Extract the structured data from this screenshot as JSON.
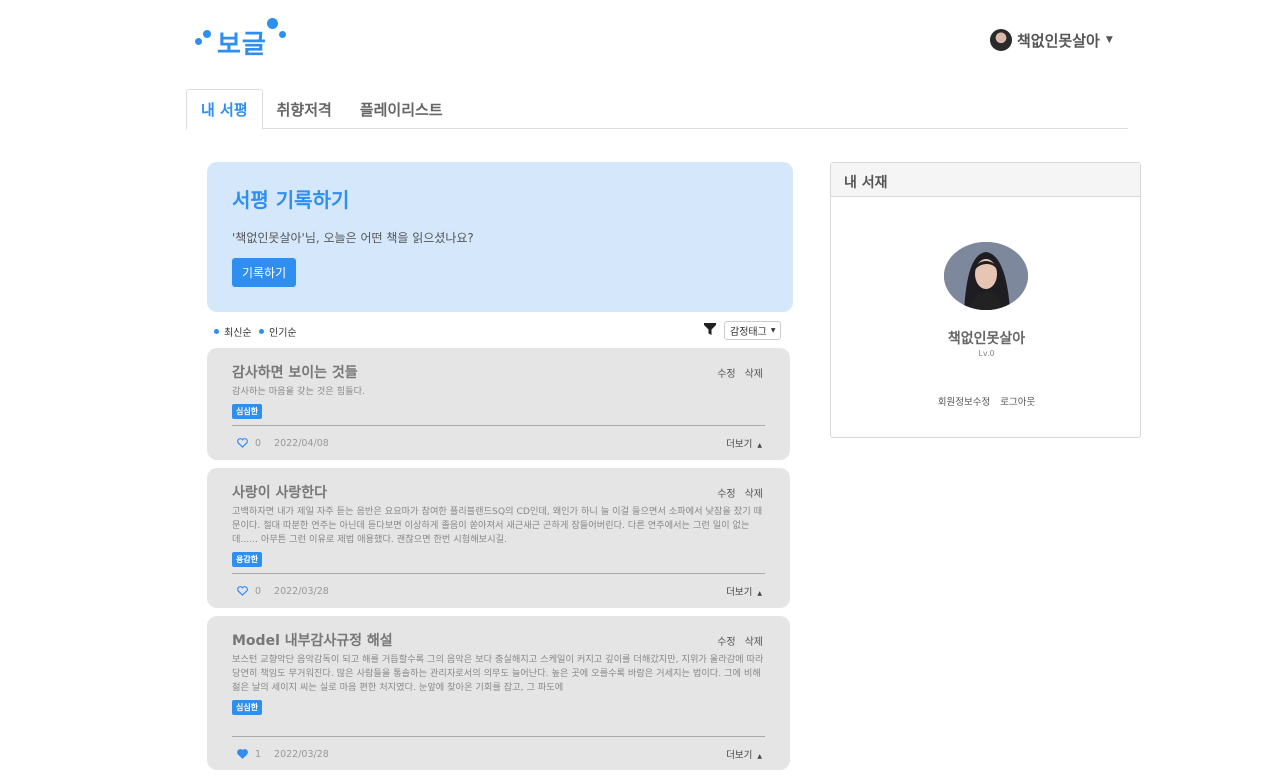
{
  "brand": {
    "logo_text": "보글",
    "color": "#2e8ff0"
  },
  "user": {
    "name": "책없인못살아"
  },
  "tabs": [
    {
      "label": "내 서평",
      "active": true
    },
    {
      "label": "취향저격",
      "active": false
    },
    {
      "label": "플레이리스트",
      "active": false
    }
  ],
  "hero": {
    "title": "서평 기록하기",
    "subtitle": "'책없인못살아'님, 오늘은 어떤 책을 읽으셨나요?",
    "button": "기록하기"
  },
  "sort": {
    "latest": "최신순",
    "popular": "인기순",
    "tag_select": "감정태그"
  },
  "reviews": [
    {
      "title": "감사하면 보이는 것들",
      "body": "감사하는 마음을 갖는 것은 힘들다.",
      "tag": "심심한",
      "likes": "0",
      "date": "2022/04/08",
      "liked": false
    },
    {
      "title": "사랑이 사랑한다",
      "body": "고백하자면 내가 제일 자주 듣는 음반은 요요마가 참여한 플리블랜드SQ의 CD인데, 왜인가 하니 늘 이걸 들으면서 소파에서 낮잠을 잤기 때문이다. 절대 따분한 연주는 아닌데 듣다보면 이상하게 졸음이 쏟아져서 새근새근 곤하게 잠들어버린다. 다른 연주에서는 그런 일이 없는데...... 아무튼 그런 이유로 제법 애용했다. 괜찮으면 한번 시험해보시길.",
      "tag": "용감한",
      "likes": "0",
      "date": "2022/03/28",
      "liked": false
    },
    {
      "title": "Model 내부감사규정 해설",
      "body": "보스턴 교향악단 음악감독이 되고 해를 거듭할수록 그의 음악은 보다 충실해지고 스케일이 커지고 깊이를 더해갔지만, 지위가 올라감에 따라 당연히 책임도 무거워진다. 많은 사람들을 통솔하는 관리자로서의 의무도 늘어난다. 높은 곳에 오를수록 바람은 거세지는 법이다. 그에 비해 젊은 날의 세이지 씨는 실로 마음 편한 처지였다. 눈앞에 찾아온 기회를 잡고, 그 파도에",
      "tag": "심심한",
      "likes": "1",
      "date": "2022/03/28",
      "liked": true
    }
  ],
  "card_actions": {
    "edit": "수정",
    "delete": "삭제",
    "more": "더보기"
  },
  "side": {
    "title": "내 서재",
    "name": "책없인못살아",
    "level": "Lv.0",
    "edit_profile": "회원정보수정",
    "logout": "로그아웃"
  }
}
